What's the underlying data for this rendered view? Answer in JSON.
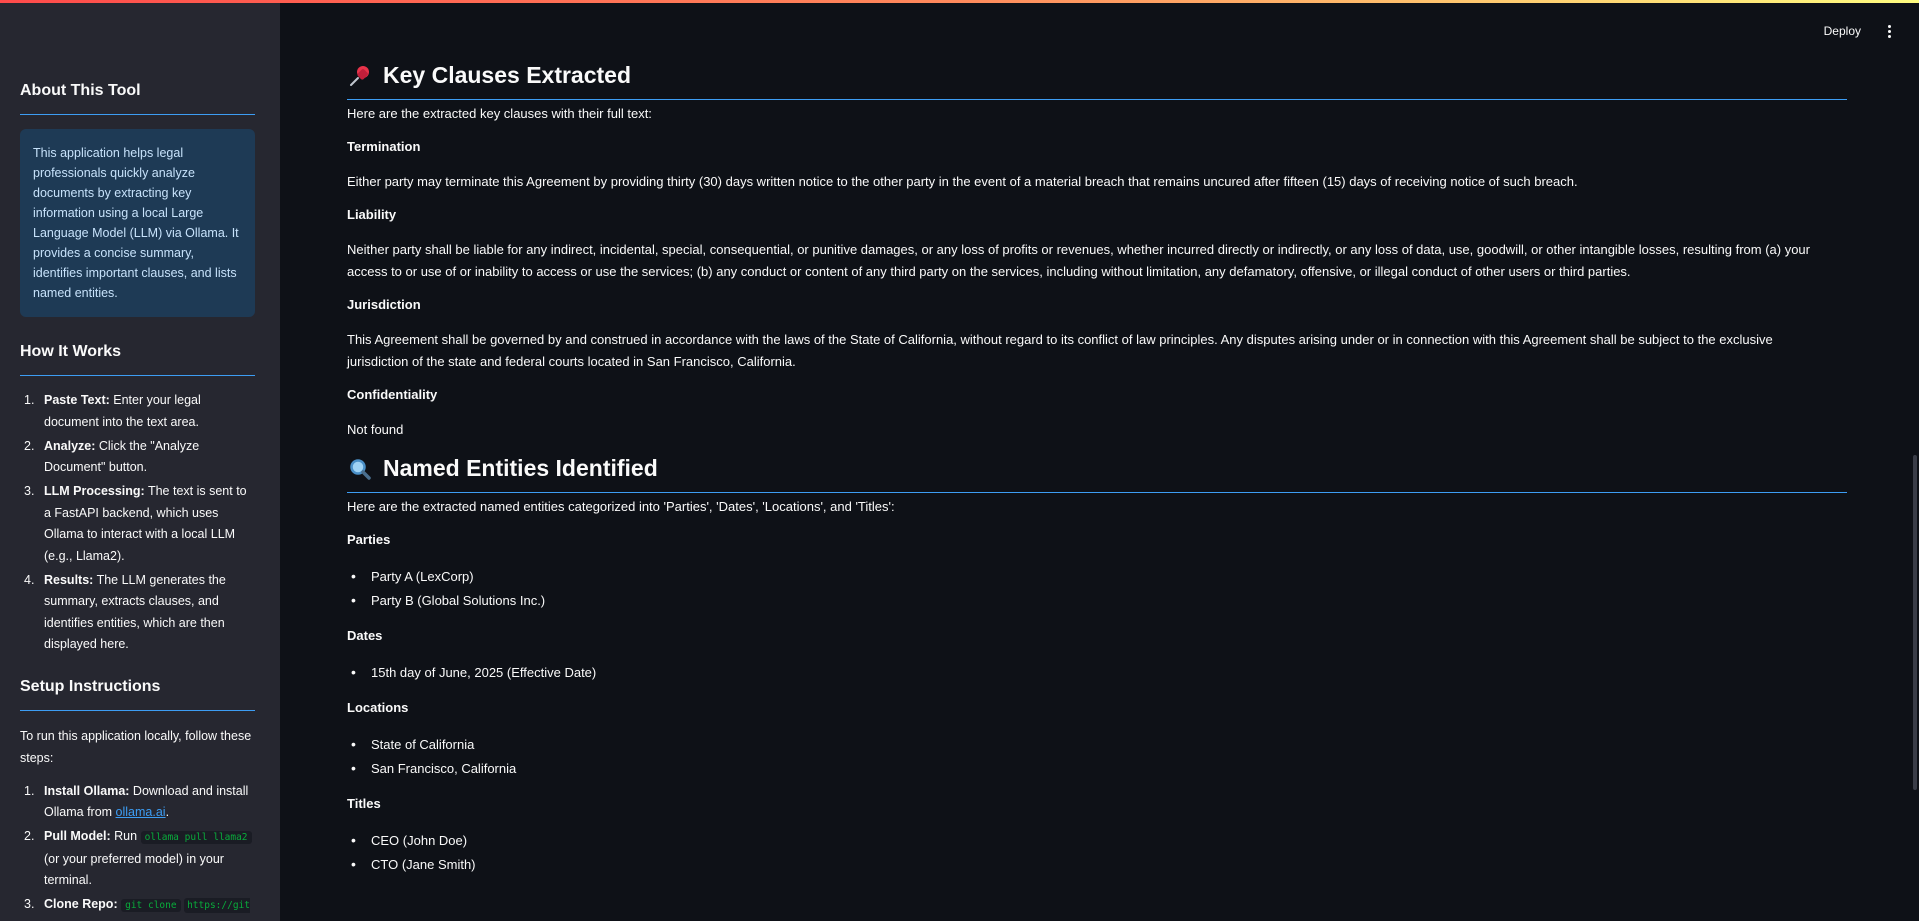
{
  "header": {
    "deploy_label": "Deploy",
    "menu_icon": "more-vertical-icon"
  },
  "sidebar": {
    "about": {
      "heading": "About This Tool",
      "info": "This application helps legal professionals quickly analyze documents by extracting key information using a local Large Language Model (LLM) via Ollama. It provides a concise summary, identifies important clauses, and lists named entities."
    },
    "how": {
      "heading": "How It Works",
      "steps": [
        {
          "num": "1.",
          "bold": "Paste Text:",
          "text": " Enter your legal document into the text area."
        },
        {
          "num": "2.",
          "bold": "Analyze:",
          "text": " Click the \"Analyze Document\" button."
        },
        {
          "num": "3.",
          "bold": "LLM Processing:",
          "text": " The text is sent to a FastAPI backend, which uses Ollama to interact with a local LLM (e.g., Llama2)."
        },
        {
          "num": "4.",
          "bold": "Results:",
          "text": " The LLM generates the summary, extracts clauses, and identifies entities, which are then displayed here."
        }
      ]
    },
    "setup": {
      "heading": "Setup Instructions",
      "intro": "To run this application locally, follow these steps:",
      "step1": {
        "num": "1.",
        "bold": "Install Ollama:",
        "text": " Download and install Ollama from ",
        "link": "ollama.ai",
        "end": "."
      },
      "step2": {
        "num": "2.",
        "bold": "Pull Model:",
        "text": " Run ",
        "code": "ollama pull llama2",
        "end": " (or your preferred model) in your terminal."
      },
      "step3": {
        "num": "3.",
        "bold": "Clone Repo:",
        "code1": "git clone",
        "code2": "https://github.com/yourusername/legal-analyzer-lexpro.git"
      }
    }
  },
  "clauses": {
    "title": "Key Clauses Extracted",
    "intro": "Here are the extracted key clauses with their full text:",
    "items": [
      {
        "name": "Termination",
        "text": "Either party may terminate this Agreement by providing thirty (30) days written notice to the other party in the event of a material breach that remains uncured after fifteen (15) days of receiving notice of such breach."
      },
      {
        "name": "Liability",
        "text": "Neither party shall be liable for any indirect, incidental, special, consequential, or punitive damages, or any loss of profits or revenues, whether incurred directly or indirectly, or any loss of data, use, goodwill, or other intangible losses, resulting from (a) your access to or use of or inability to access or use the services; (b) any conduct or content of any third party on the services, including without limitation, any defamatory, offensive, or illegal conduct of other users or third parties."
      },
      {
        "name": "Jurisdiction",
        "text": "This Agreement shall be governed by and construed in accordance with the laws of the State of California, without regard to its conflict of law principles. Any disputes arising under or in connection with this Agreement shall be subject to the exclusive jurisdiction of the state and federal courts located in San Francisco, California."
      },
      {
        "name": "Confidentiality",
        "text": "Not found"
      }
    ]
  },
  "entities": {
    "title": "Named Entities Identified",
    "intro": "Here are the extracted named entities categorized into 'Parties', 'Dates', 'Locations', and 'Titles':",
    "groups": [
      {
        "name": "Parties",
        "items": [
          "Party A (LexCorp)",
          "Party B (Global Solutions Inc.)"
        ]
      },
      {
        "name": "Dates",
        "items": [
          "15th day of June, 2025 (Effective Date)"
        ]
      },
      {
        "name": "Locations",
        "items": [
          "State of California",
          "San Francisco, California"
        ]
      },
      {
        "name": "Titles",
        "items": [
          "CEO (John Doe)",
          "CTO (Jane Smith)"
        ]
      }
    ]
  },
  "icons": {
    "clauses": "pushpin-icon",
    "entities": "magnifier-icon"
  },
  "colors": {
    "accent": "#3d9df3",
    "info_bg": "#1e3a55",
    "code": "#09ab3b"
  }
}
